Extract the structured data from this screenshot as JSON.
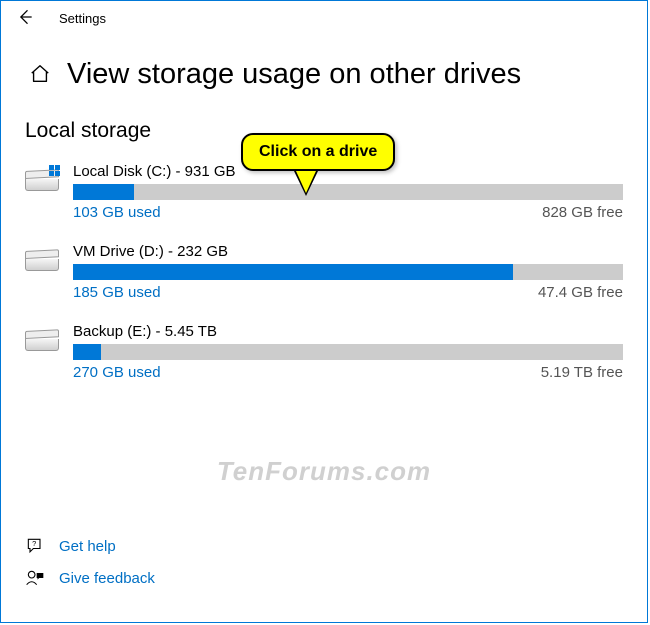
{
  "app_name": "Settings",
  "page_title": "View storage usage on other drives",
  "section_title": "Local storage",
  "callout_text": "Click on a drive",
  "watermark": "TenForums.com",
  "drives": [
    {
      "label": "Local Disk (C:) - 931 GB",
      "used": "103 GB used",
      "free": "828 GB free",
      "percent": 11,
      "os": true
    },
    {
      "label": "VM Drive (D:) - 232 GB",
      "used": "185 GB used",
      "free": "47.4 GB free",
      "percent": 80,
      "os": false
    },
    {
      "label": "Backup (E:) - 5.45 TB",
      "used": "270 GB used",
      "free": "5.19 TB free",
      "percent": 5,
      "os": false
    }
  ],
  "footer": {
    "get_help": "Get help",
    "give_feedback": "Give feedback"
  }
}
